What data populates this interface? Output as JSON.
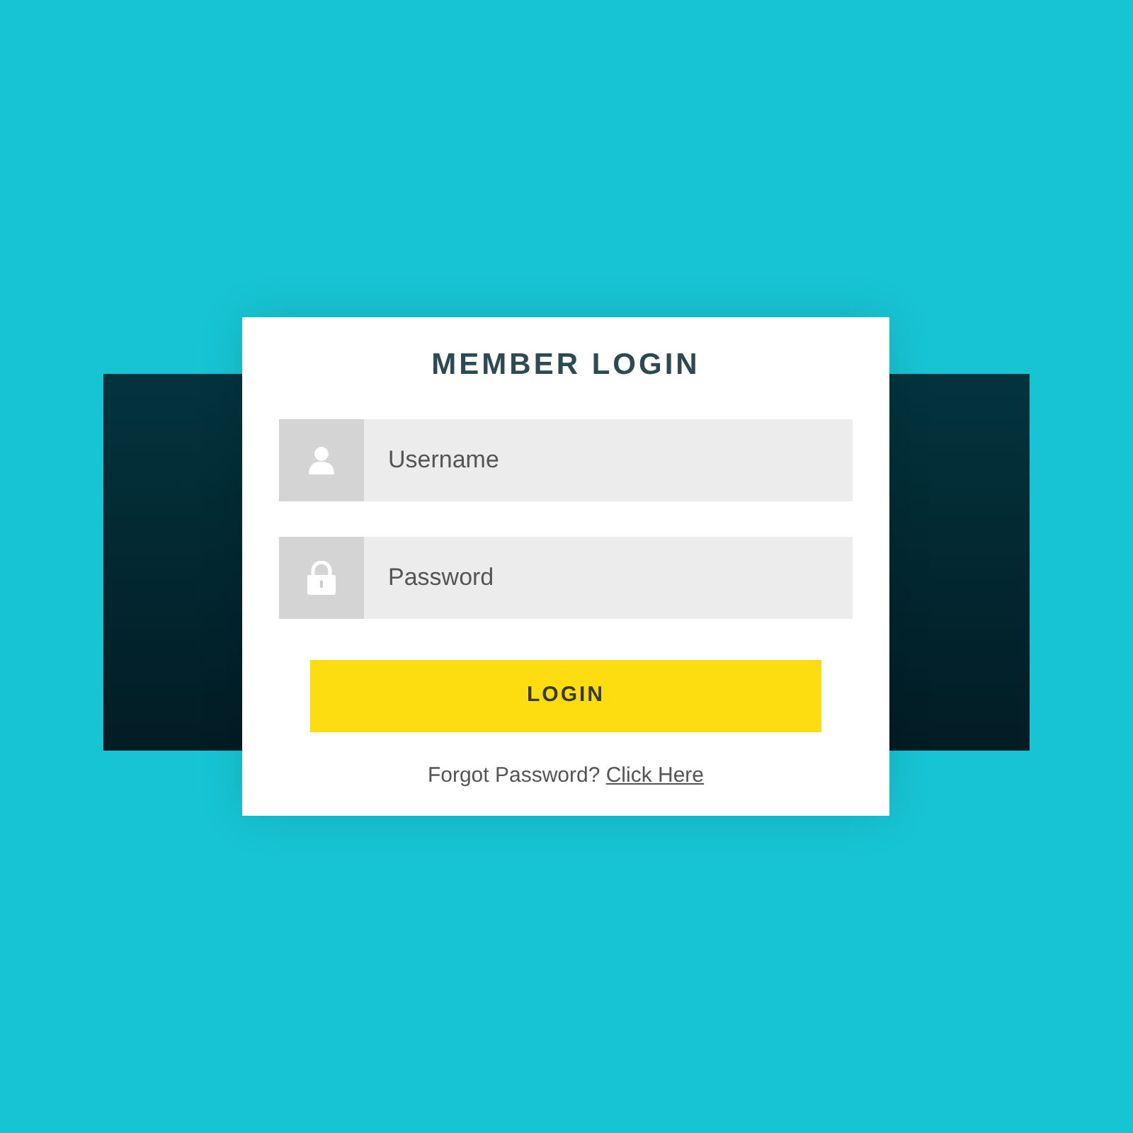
{
  "form": {
    "title": "MEMBER LOGIN",
    "fields": [
      {
        "kind": "user",
        "placeholder": "Username"
      },
      {
        "kind": "password",
        "placeholder": "Password"
      }
    ],
    "button": "LOGIN",
    "footer": {
      "text": "Forgot Password?",
      "link": "Click Here"
    }
  }
}
